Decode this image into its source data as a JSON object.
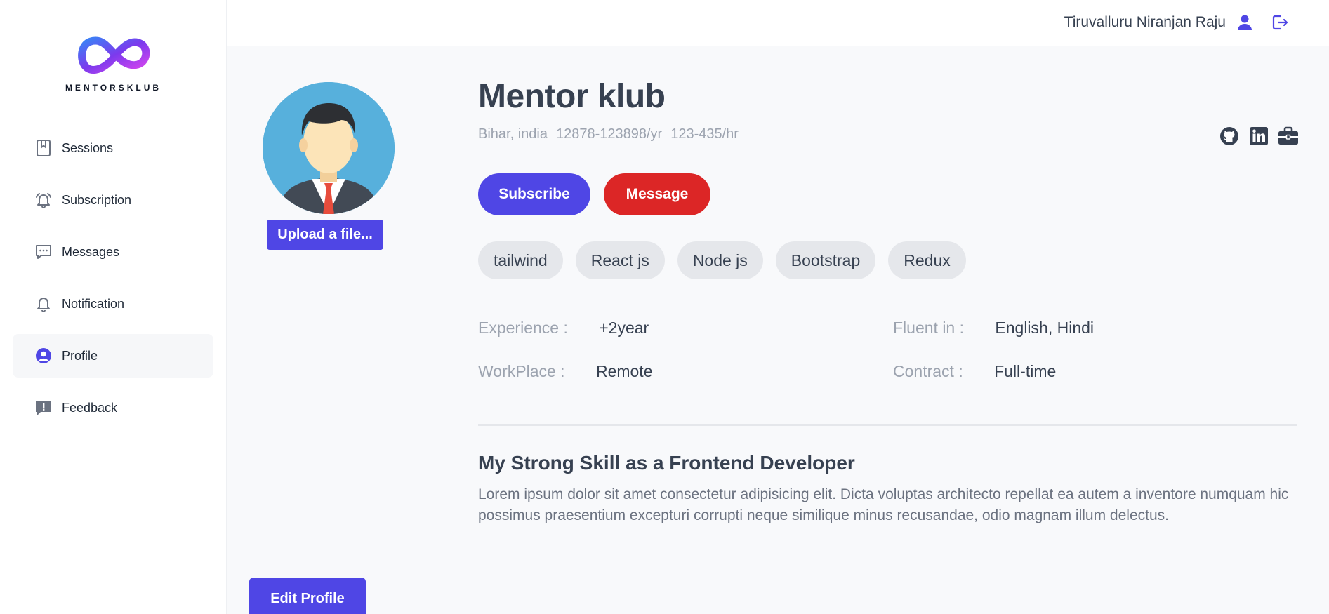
{
  "app": {
    "brand": "MENTORSKLUB"
  },
  "topbar": {
    "user_name": "Tiruvalluru Niranjan Raju"
  },
  "sidebar": {
    "items": [
      {
        "label": "Sessions",
        "icon": "bookmark-icon",
        "active": false
      },
      {
        "label": "Subscription",
        "icon": "bell-ring-icon",
        "active": false
      },
      {
        "label": "Messages",
        "icon": "chat-icon",
        "active": false
      },
      {
        "label": "Notification",
        "icon": "bell-icon",
        "active": false
      },
      {
        "label": "Profile",
        "icon": "user-circle-icon",
        "active": true
      },
      {
        "label": "Feedback",
        "icon": "feedback-icon",
        "active": false
      }
    ]
  },
  "profile": {
    "name": "Mentor klub",
    "location": "Bihar, india",
    "salary": "12878-123898/yr",
    "rate": "123-435/hr",
    "upload_label": "Upload a file...",
    "edit_label": "Edit Profile",
    "subscribe_label": "Subscribe",
    "message_label": "Message",
    "tags": [
      "tailwind",
      "React js",
      "Node js",
      "Bootstrap",
      "Redux"
    ],
    "experience_key": "Experience :",
    "experience_value": "+2year",
    "workplace_key": "WorkPlace :",
    "workplace_value": "Remote",
    "fluent_key": "Fluent in :",
    "fluent_value": "English, Hindi",
    "contract_key": "Contract :",
    "contract_value": "Full-time",
    "section_title": "My Strong Skill as a Frontend Developer",
    "section_text": "Lorem ipsum dolor sit amet consectetur adipisicing elit. Dicta voluptas architecto repellat ea autem a inventore numquam hic possimus praesentium excepturi corrupti neque similique minus recusandae, odio magnam illum delectus."
  },
  "socials": [
    "github-icon",
    "linkedin-icon",
    "briefcase-icon"
  ],
  "colors": {
    "primary": "#4f46e5",
    "danger": "#dc2626",
    "tag_bg": "#e5e7eb",
    "muted": "#9ca3af"
  }
}
